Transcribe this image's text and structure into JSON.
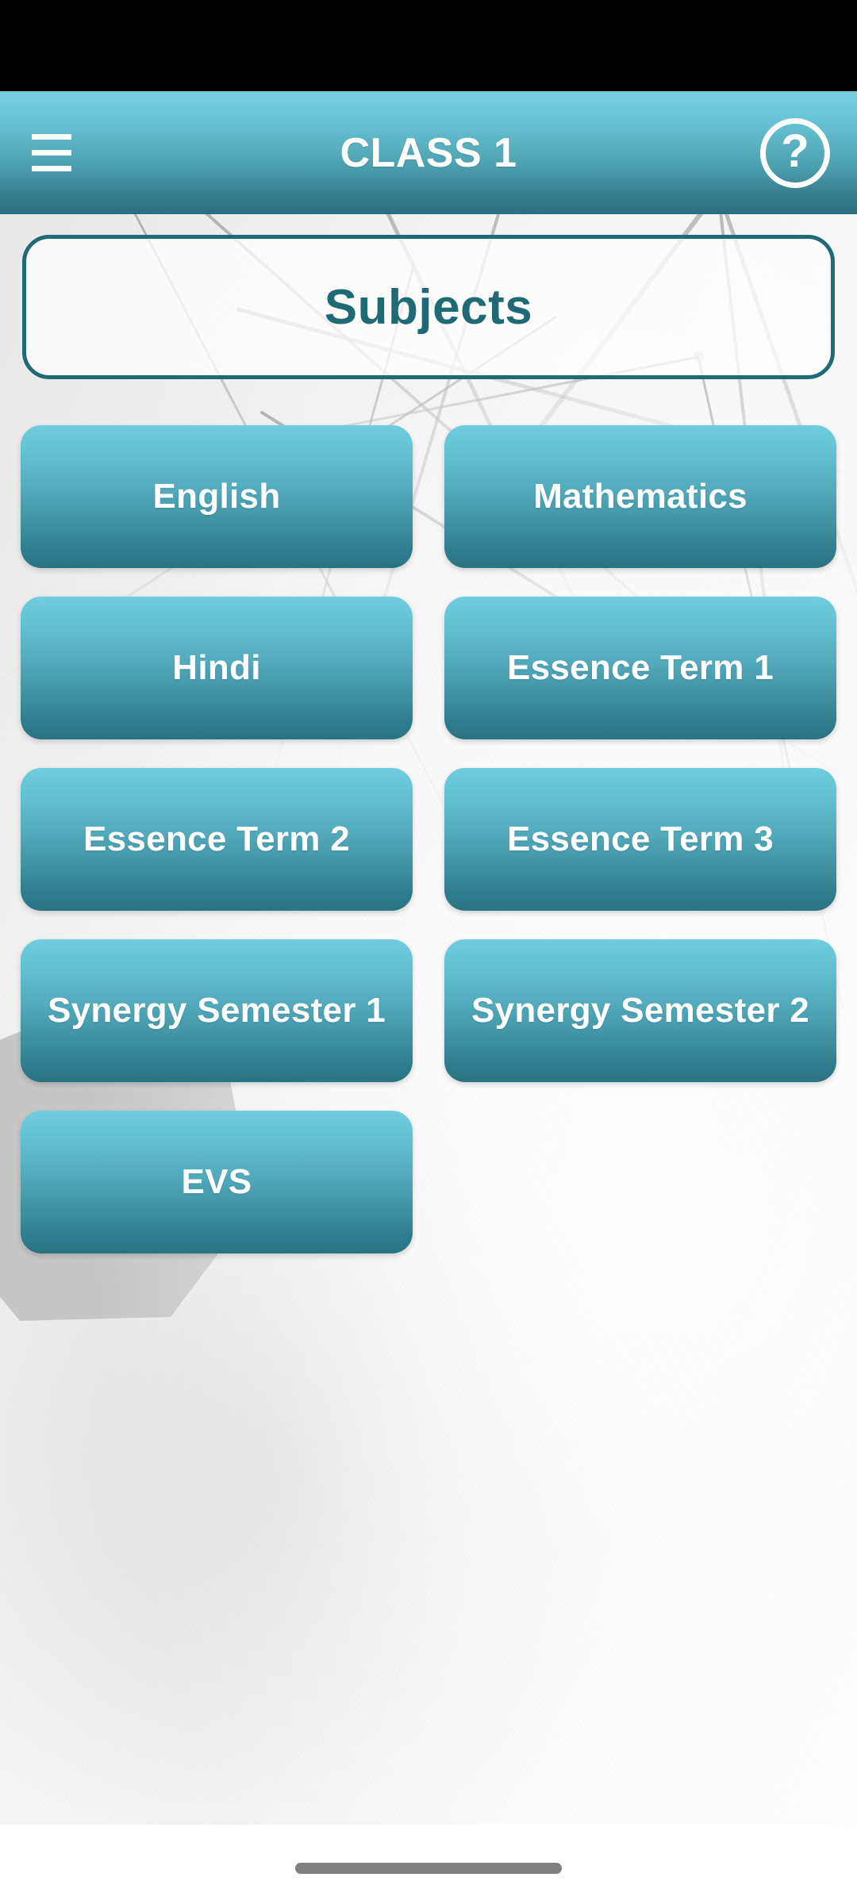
{
  "status_bar": {
    "visible": true
  },
  "appbar": {
    "title": "CLASS 1",
    "menu_icon": "hamburger-menu-icon",
    "help_icon": "help-circle-icon",
    "help_glyph": "?"
  },
  "section_header": {
    "label": "Subjects"
  },
  "subjects": [
    {
      "label": "English"
    },
    {
      "label": "Mathematics"
    },
    {
      "label": "Hindi"
    },
    {
      "label": "Essence Term 1"
    },
    {
      "label": "Essence Term 2"
    },
    {
      "label": "Essence Term 3"
    },
    {
      "label": "Synergy Semester 1"
    },
    {
      "label": "Synergy Semester 2"
    },
    {
      "label": "EVS"
    }
  ],
  "colors": {
    "accent_teal_dark": "#1F6A75",
    "button_gradient_top": "#6FCDDE",
    "button_gradient_bottom": "#2A7383",
    "appbar_gradient_top": "#76CFDF",
    "appbar_gradient_bottom": "#2C6E80",
    "text_on_accent": "#FFFFFF",
    "home_indicator": "#808080",
    "background": "#F4F4F4"
  },
  "bottom_nav": {
    "home_indicator": "home-indicator"
  }
}
